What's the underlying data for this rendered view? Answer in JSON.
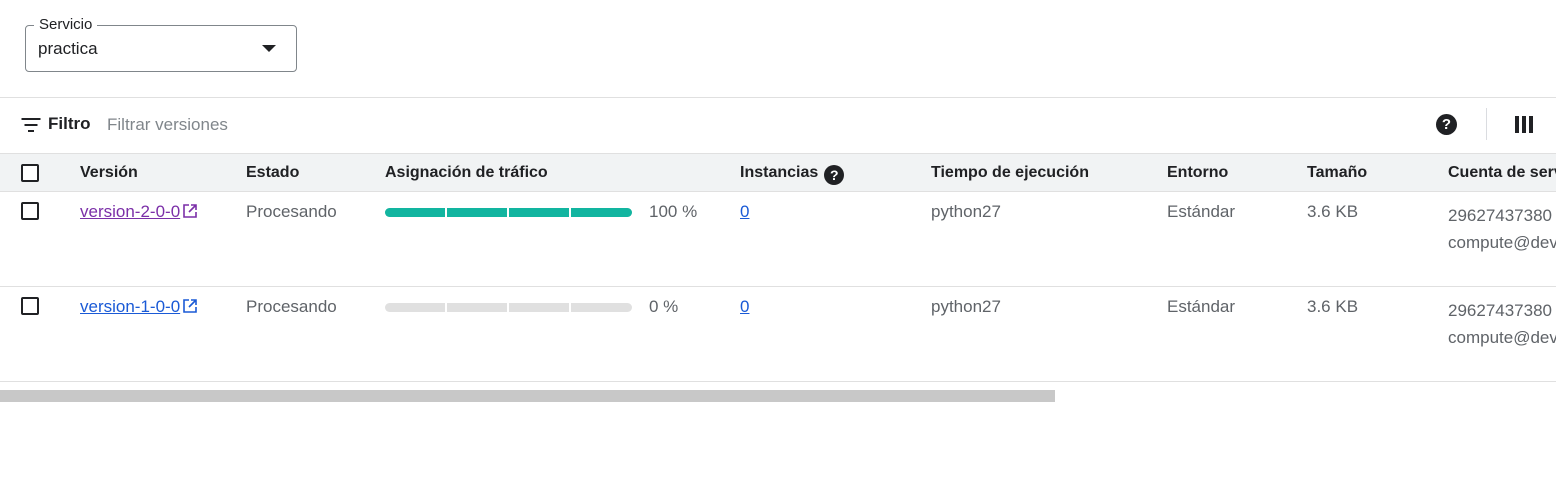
{
  "service": {
    "label": "Servicio",
    "value": "practica"
  },
  "filter": {
    "label": "Filtro",
    "placeholder": "Filtrar versiones"
  },
  "icons": {
    "filter": "filter-list-icon",
    "help": "help-icon",
    "columns": "column-display-icon",
    "external": "open-in-new-icon",
    "dropdown": "arrow-drop-down-icon"
  },
  "colors": {
    "traffic_fill": "#12b5a0",
    "visited_link": "#7b2fa8",
    "link": "#1a5ad6"
  },
  "table": {
    "headers": {
      "version": "Versión",
      "status": "Estado",
      "traffic": "Asignación de tráfico",
      "instances": "Instancias",
      "runtime": "Tiempo de ejecución",
      "environment": "Entorno",
      "size": "Tamaño",
      "service_account": "Cuenta de serv"
    },
    "rows": [
      {
        "version": "version-2-0-0",
        "status": "Procesando",
        "traffic_fraction": 1.0,
        "traffic_label": "100 %",
        "instances": "0",
        "runtime": "python27",
        "environment": "Estándar",
        "size": "3.6 KB",
        "account_line1": "29627437380",
        "account_line2": "compute@dev"
      },
      {
        "version": "version-1-0-0",
        "status": "Procesando",
        "traffic_fraction": 0.0,
        "traffic_label": "0 %",
        "instances": "0",
        "runtime": "python27",
        "environment": "Estándar",
        "size": "3.6 KB",
        "account_line1": "29627437380",
        "account_line2": "compute@dev"
      }
    ]
  }
}
